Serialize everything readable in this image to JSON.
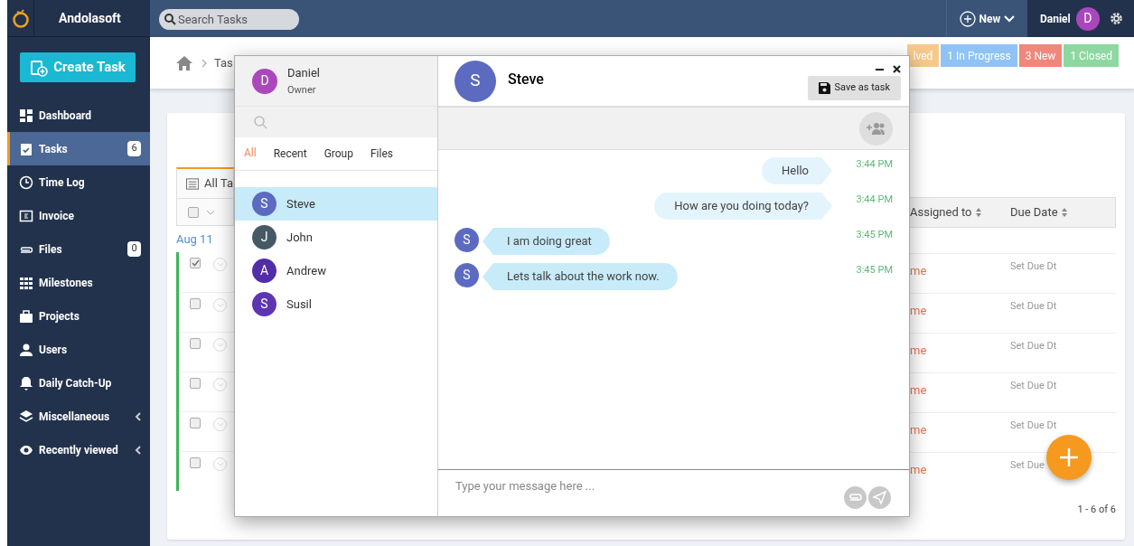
{
  "app": {
    "brand": "Andolasoft",
    "search_placeholder": "Search Tasks",
    "new_button": "New",
    "user": {
      "name": "Daniel",
      "initial": "D"
    }
  },
  "create_button": "Create Task",
  "sidebar": {
    "items": [
      {
        "label": "Dashboard",
        "selected": false
      },
      {
        "label": "Tasks",
        "selected": true,
        "badge": "6"
      },
      {
        "label": "Time Log",
        "selected": false
      },
      {
        "label": "Invoice",
        "selected": false
      },
      {
        "label": "Files",
        "selected": false,
        "badge": "0"
      },
      {
        "label": "Milestones",
        "selected": false
      },
      {
        "label": "Projects",
        "selected": false
      },
      {
        "label": "Users",
        "selected": false
      },
      {
        "label": "Daily Catch-Up",
        "selected": false
      },
      {
        "label": "Miscellaneous",
        "selected": false,
        "expandable": true
      },
      {
        "label": "Recently viewed",
        "selected": false,
        "expandable": true
      }
    ]
  },
  "breadcrumb": "Tas",
  "status_chips": [
    {
      "label": "lved",
      "color": "#f6c98b"
    },
    {
      "label": "1 In Progress",
      "color": "#8fc3f5"
    },
    {
      "label": "3 New",
      "color": "#f0877a"
    },
    {
      "label": "1 Closed",
      "color": "#8dd8a0"
    }
  ],
  "tasks": {
    "select_all_checked": false,
    "list_title": "All Ta",
    "date_group": "Aug 11",
    "columns": [
      "Assigned to",
      "Due Date"
    ],
    "rows": [
      {
        "checked": true,
        "assigned": "me",
        "due": "Set Due Dt"
      },
      {
        "checked": false,
        "assigned": "me",
        "due": "Set Due Dt"
      },
      {
        "checked": false,
        "assigned": "me",
        "due": "Set Due Dt"
      },
      {
        "checked": false,
        "assigned": "me",
        "due": "Set Due Dt"
      },
      {
        "checked": false,
        "assigned": "me",
        "due": "Set Due Dt"
      },
      {
        "checked": false,
        "assigned": "me",
        "due": "Set Due"
      }
    ],
    "pagination": "1 - 6 of 6"
  },
  "chat": {
    "owner": {
      "name": "Daniel",
      "role": "Owner",
      "initial": "D"
    },
    "tabs": [
      {
        "label": "All",
        "selected": true
      },
      {
        "label": "Recent",
        "selected": false
      },
      {
        "label": "Group",
        "selected": false
      },
      {
        "label": "Files",
        "selected": false
      }
    ],
    "contacts": [
      {
        "name": "Steve",
        "initial": "S",
        "color": "#5c6bc0",
        "selected": true
      },
      {
        "name": "John",
        "initial": "J",
        "color": "#455a64",
        "selected": false
      },
      {
        "name": "Andrew",
        "initial": "A",
        "color": "#512da8",
        "selected": false
      },
      {
        "name": "Susil",
        "initial": "S",
        "color": "#5e35b1",
        "selected": false
      }
    ],
    "peer": {
      "name": "Steve",
      "initial": "S"
    },
    "save_button": "Save as task",
    "messages": [
      {
        "kind": "sent",
        "text": "Hello",
        "time": "3:44 PM"
      },
      {
        "kind": "sent",
        "text": "How are you doing today?",
        "time": "3:44 PM"
      },
      {
        "kind": "received",
        "initial": "S",
        "text": "I am doing great",
        "time": "3:45 PM"
      },
      {
        "kind": "received",
        "initial": "S",
        "text": "Lets talk about the work now.",
        "time": "3:45 PM"
      }
    ],
    "input": {
      "placeholder": "Type your message here ..."
    }
  }
}
